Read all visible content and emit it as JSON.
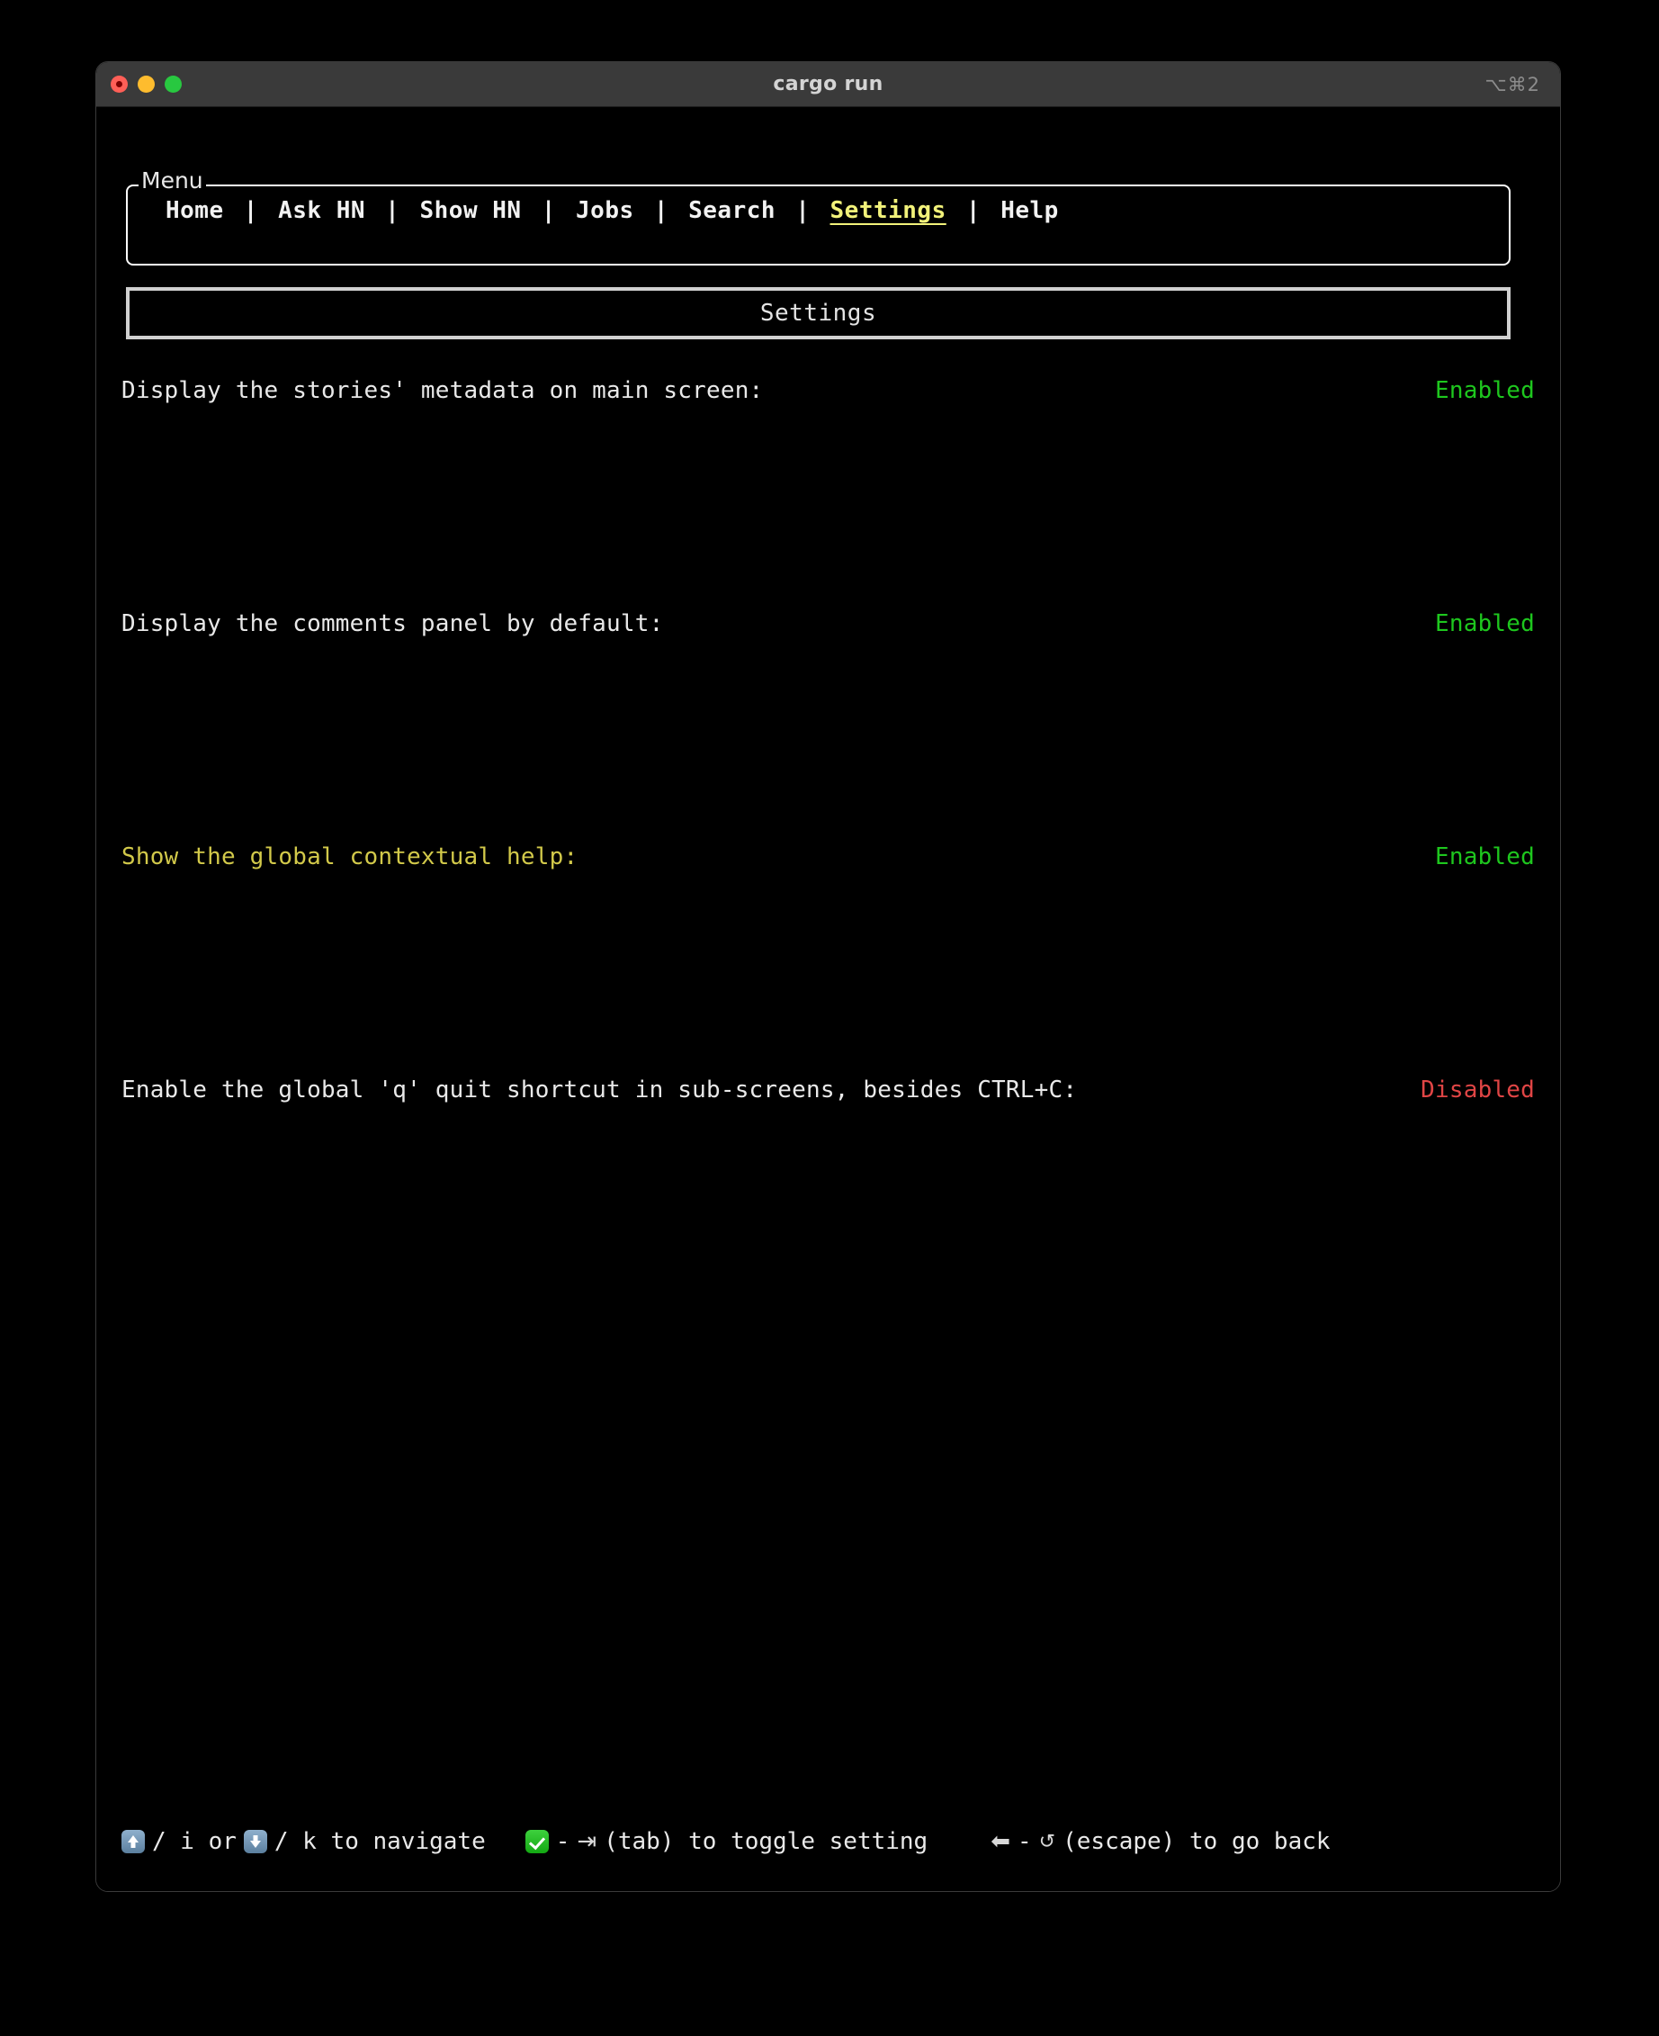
{
  "window": {
    "title": "cargo run",
    "shortcut": "⌥⌘2",
    "traffic_lights": {
      "close_label": "close",
      "minimize_label": "minimize",
      "maximize_label": "maximize"
    }
  },
  "menu": {
    "legend": "Menu",
    "separator": "|",
    "items": [
      {
        "label": "Home",
        "active": false
      },
      {
        "label": "Ask HN",
        "active": false
      },
      {
        "label": "Show HN",
        "active": false
      },
      {
        "label": "Jobs",
        "active": false
      },
      {
        "label": "Search",
        "active": false
      },
      {
        "label": "Settings",
        "active": true
      },
      {
        "label": "Help",
        "active": false
      }
    ]
  },
  "screen": {
    "title": "Settings"
  },
  "settings": {
    "value_enabled": "Enabled",
    "value_disabled": "Disabled",
    "rows": [
      {
        "label": "Display the stories' metadata on main screen:",
        "value": "Enabled",
        "state": "on",
        "selected": false
      },
      {
        "label": "Display the comments panel by default:",
        "value": "Enabled",
        "state": "on",
        "selected": false
      },
      {
        "label": "Show the global contextual help:",
        "value": "Enabled",
        "state": "on",
        "selected": true
      },
      {
        "label": "Enable the global 'q' quit shortcut in sub-screens, besides CTRL+C:",
        "value": "Disabled",
        "state": "off",
        "selected": false
      }
    ]
  },
  "footer": {
    "hints": [
      {
        "icon_up": "up-arrow-key-icon",
        "icon_down": "down-arrow-key-icon",
        "text_mid": "/ i or",
        "text_end": "/ k to navigate"
      },
      {
        "icon": "green-check-icon",
        "dash": "-",
        "tab_glyph": "⇥",
        "text": "(tab) to toggle setting"
      },
      {
        "back_glyph": "⬅",
        "dash": "-",
        "escape_glyph": "↺",
        "text": "(escape) to go back"
      }
    ]
  },
  "colors": {
    "enabled": "#1ec71e",
    "disabled": "#e04545",
    "selected": "#d2c94a",
    "accent": "#f2f27a",
    "background": "#000000",
    "titlebar": "#3a3a3a"
  }
}
